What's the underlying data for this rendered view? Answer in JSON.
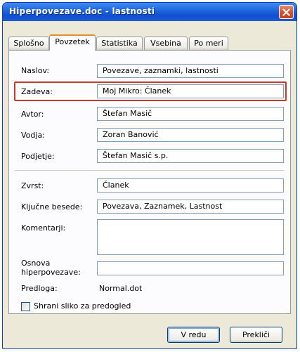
{
  "window": {
    "title": "Hiperpovezave.doc - lastnosti",
    "close_icon": "close-icon"
  },
  "tabs": [
    {
      "label": "Splošno"
    },
    {
      "label": "Povzetek",
      "active": true
    },
    {
      "label": "Statistika"
    },
    {
      "label": "Vsebina"
    },
    {
      "label": "Po meri"
    }
  ],
  "fields": {
    "naslov": {
      "label": "Naslov:",
      "value": "Povezave, zaznamki, lastnosti"
    },
    "zadeva": {
      "label": "Zadeva:",
      "value": "Moj Mikro: Članek"
    },
    "avtor": {
      "label": "Avtor:",
      "value": "Štefan Masič"
    },
    "vodja": {
      "label": "Vodja:",
      "value": "Zoran Banović"
    },
    "podjetje": {
      "label": "Podjetje:",
      "value": "Štefan Masič s.p."
    },
    "zvrst": {
      "label": "Zvrst:",
      "value": "Članek"
    },
    "kljucne": {
      "label": "Ključne besede:",
      "value": "Povezava, Zaznamek, Lastnost"
    },
    "komentarji": {
      "label": "Komentarji:",
      "value": ""
    },
    "osnova": {
      "label_line1": "Osnova",
      "label_line2": "hiperpovezave:",
      "value": ""
    },
    "predloga": {
      "label": "Predloga:",
      "value": "Normal.dot"
    }
  },
  "checkbox": {
    "label": "Shrani sliko za predogled",
    "checked": false
  },
  "buttons": {
    "ok": "V redu",
    "cancel": "Prekliči"
  },
  "colors": {
    "highlight": "#c0392b",
    "title_bar": "#1f63db",
    "active_tab_accent": "#e68b2c"
  }
}
